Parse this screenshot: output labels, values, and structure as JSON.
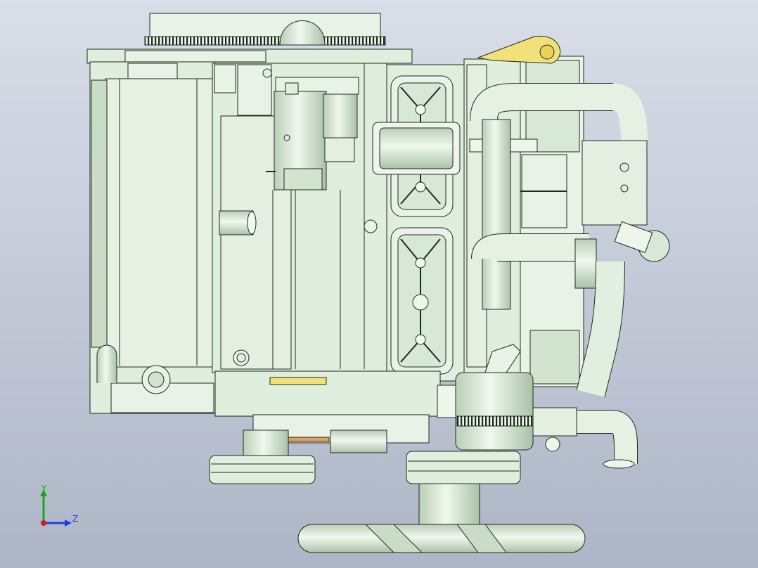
{
  "viewport": {
    "background_top": "#d9dee8",
    "background_bottom": "#aeb5c6"
  },
  "model": {
    "body_color": "#dfeedd",
    "body_shade": "#c6dcc4",
    "edge_color": "#1f2a1f",
    "accent_yellow": "#f2e17a",
    "accent_orange": "#e8a060"
  },
  "triad": {
    "y_label": "Y",
    "z_label": "Z",
    "y_color": "#1aa51a",
    "z_color": "#1d3fe0",
    "x_color": "#d21d1d"
  }
}
